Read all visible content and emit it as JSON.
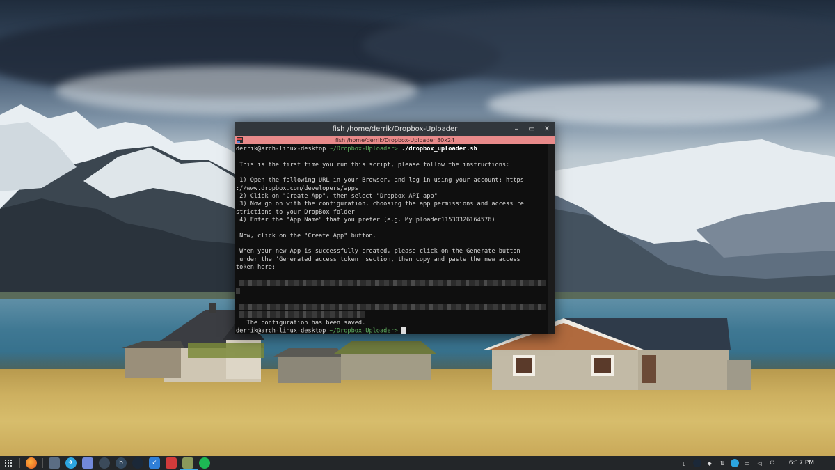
{
  "terminal": {
    "title": "fish  /home/derrik/Dropbox-Uploader",
    "tab_title": "fish  /home/derrik/Dropbox-Uploader 80x24",
    "buttons": {
      "minimize": "–",
      "maximize": "▭",
      "close": "✕"
    },
    "prompt_user": "derrik@arch-linux-desktop",
    "prompt_path": " ~/Dropbox-Uploader>",
    "command": " ./dropbox_uploader.sh",
    "lines": [
      "",
      " This is the first time you run this script, please follow the instructions:",
      "",
      " 1) Open the following URL in your Browser, and log in using your account: https",
      "://www.dropbox.com/developers/apps",
      " 2) Click on \"Create App\", then select \"Dropbox API app\"",
      " 3) Now go on with the configuration, choosing the app permissions and access re",
      "strictions to your DropBox folder",
      " 4) Enter the \"App Name\" that you prefer (e.g. MyUploader11530326164576)",
      "",
      " Now, click on the \"Create App\" button.",
      "",
      " When your new App is successfully created, please click on the Generate button",
      " under the 'Generated access token' section, then copy and paste the new access",
      "token here:"
    ],
    "saved_message": "   The configuration has been saved.",
    "final_prompt_user": "derrik@arch-linux-desktop",
    "final_prompt_path": " ~/Dropbox-Uploader>"
  },
  "taskbar": {
    "clock": "6:17 PM",
    "launchers": [
      "app-launcher-icon",
      "firefox-icon",
      "desktop-icon",
      "telegram-icon",
      "discord-icon",
      "app-icon",
      "budgie-icon",
      "steam-icon",
      "checkbox-icon",
      "red-app-icon",
      "files-icon",
      "spotify-icon"
    ],
    "tray": [
      "clipboard-icon",
      "steam-tray-icon",
      "dropbox-tray-icon",
      "network-icon",
      "telegram-tray-icon",
      "chat-icon",
      "volume-icon",
      "power-icon"
    ]
  },
  "colors": {
    "titlebar": "#31363b",
    "tab_accent": "#e88a8a",
    "prompt_path": "#5fae5f",
    "taskbar": "#232629",
    "highlight": "#3daee9"
  }
}
